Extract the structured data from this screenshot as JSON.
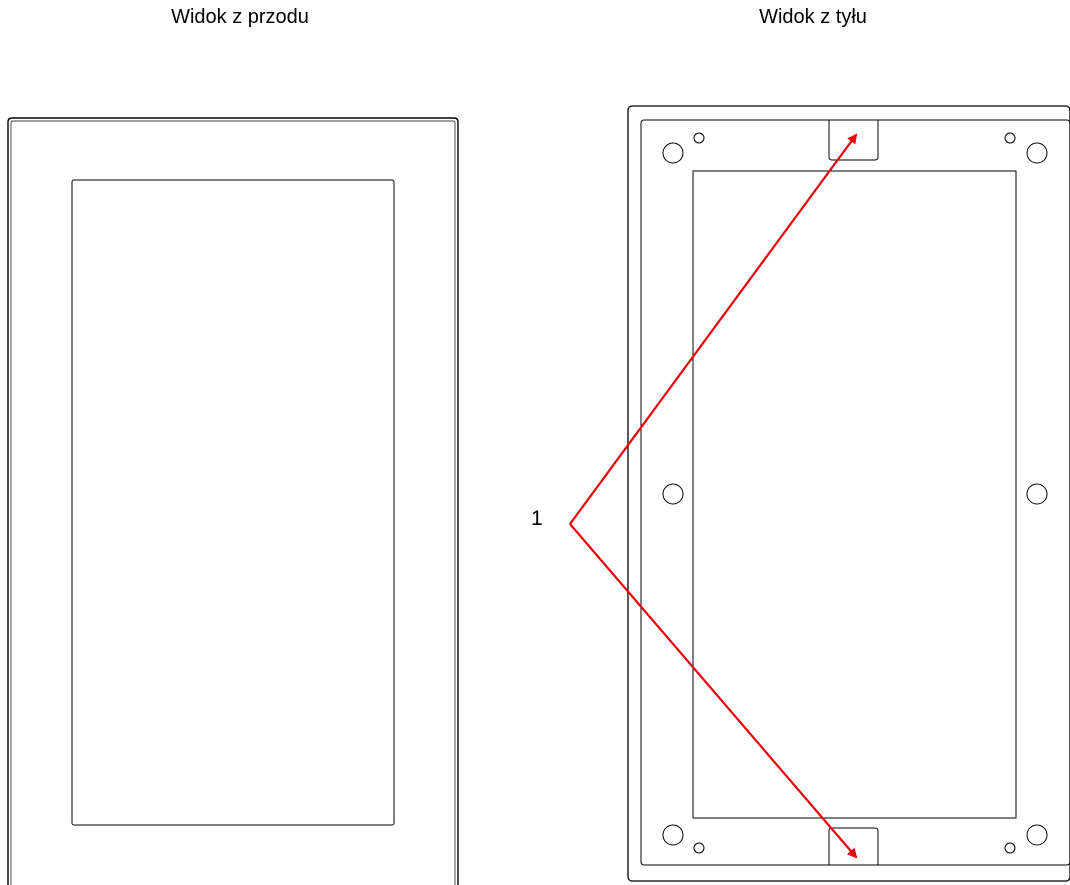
{
  "titles": {
    "front": "Widok z przodu",
    "back": "Widok z tyłu"
  },
  "callout": {
    "label": "1"
  },
  "colors": {
    "outline": "#000000",
    "arrow": "#e8000b",
    "background": "#ffffff"
  }
}
